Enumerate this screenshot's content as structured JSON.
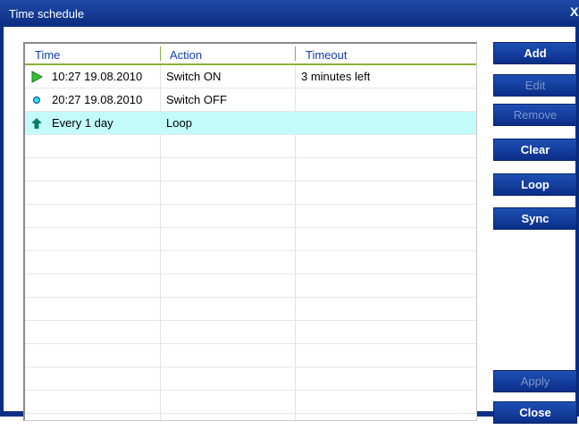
{
  "window": {
    "title": "Time schedule",
    "close_glyph": "X"
  },
  "table": {
    "columns": [
      "Time",
      "Action",
      "Timeout"
    ],
    "rows": [
      {
        "icon": "play-icon",
        "time": "10:27 19.08.2010",
        "action": "Switch ON",
        "timeout": "3 minutes left",
        "selected": false
      },
      {
        "icon": "dot-icon",
        "time": "20:27 19.08.2010",
        "action": "Switch OFF",
        "timeout": "",
        "selected": false
      },
      {
        "icon": "up-arrow-icon",
        "time": "Every 1 day",
        "action": "Loop",
        "timeout": "",
        "selected": true
      }
    ]
  },
  "buttons": {
    "add": "Add",
    "edit": "Edit",
    "remove": "Remove",
    "clear": "Clear",
    "loop": "Loop",
    "sync": "Sync",
    "apply": "Apply",
    "close": "Close"
  },
  "colors": {
    "selected_row": "#c3fbfb",
    "button_bg": "#0b2f88",
    "header_text": "#0f3fb0",
    "header_border": "#8bb03a"
  }
}
